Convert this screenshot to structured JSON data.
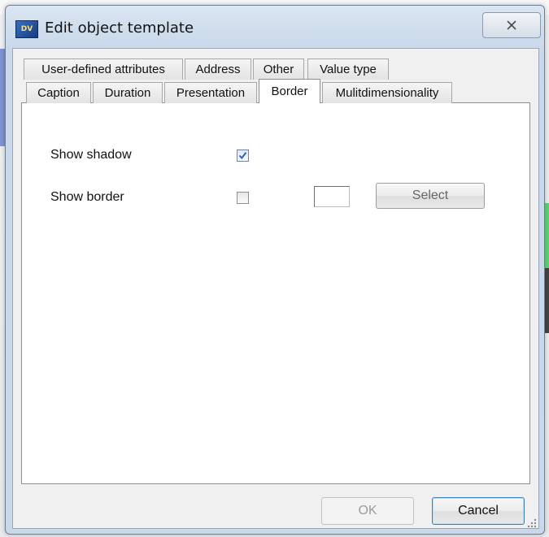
{
  "window": {
    "title": "Edit object template",
    "icon": "app-logo-icon"
  },
  "tabs": {
    "row_back": [
      {
        "label": "User-defined attributes"
      },
      {
        "label": "Address"
      },
      {
        "label": "Other"
      },
      {
        "label": "Value type"
      }
    ],
    "row_front": [
      {
        "label": "Caption"
      },
      {
        "label": "Duration"
      },
      {
        "label": "Presentation"
      },
      {
        "label": "Border",
        "active": true
      },
      {
        "label": "Mulitdimensionality"
      }
    ]
  },
  "border_page": {
    "show_shadow": {
      "label": "Show shadow",
      "checked": true
    },
    "show_border": {
      "label": "Show border",
      "checked": false
    },
    "select_button": "Select"
  },
  "footer": {
    "ok_label": "OK",
    "cancel_label": "Cancel"
  },
  "colors": {
    "title_bar": "#cfdded",
    "tab_page": "#ffffff",
    "check_accent": "#2c62b8"
  }
}
